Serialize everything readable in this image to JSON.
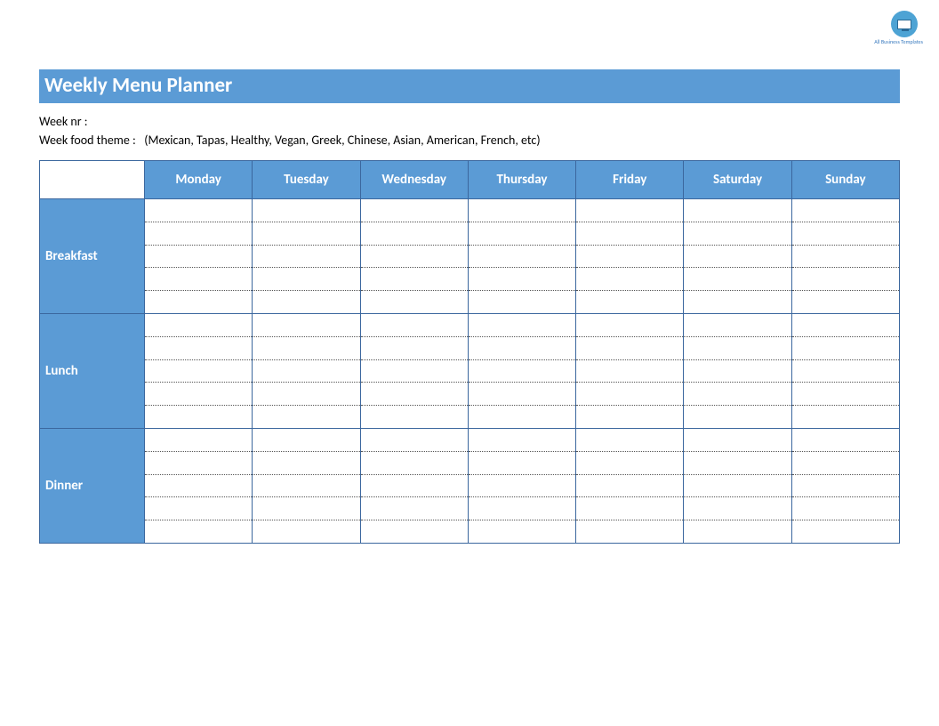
{
  "logo_label": "All Business Templates",
  "title": "Weekly Menu Planner",
  "meta": {
    "week_nr_label": "Week nr :",
    "week_nr_value": "",
    "theme_label": "Week food theme :",
    "theme_hint": "(Mexican, Tapas, Healthy, Vegan, Greek, Chinese, Asian, American, French, etc)"
  },
  "days": [
    "Monday",
    "Tuesday",
    "Wednesday",
    "Thursday",
    "Friday",
    "Saturday",
    "Sunday"
  ],
  "meals": [
    "Breakfast",
    "Lunch",
    "Dinner"
  ],
  "sub_rows_per_meal": 5
}
